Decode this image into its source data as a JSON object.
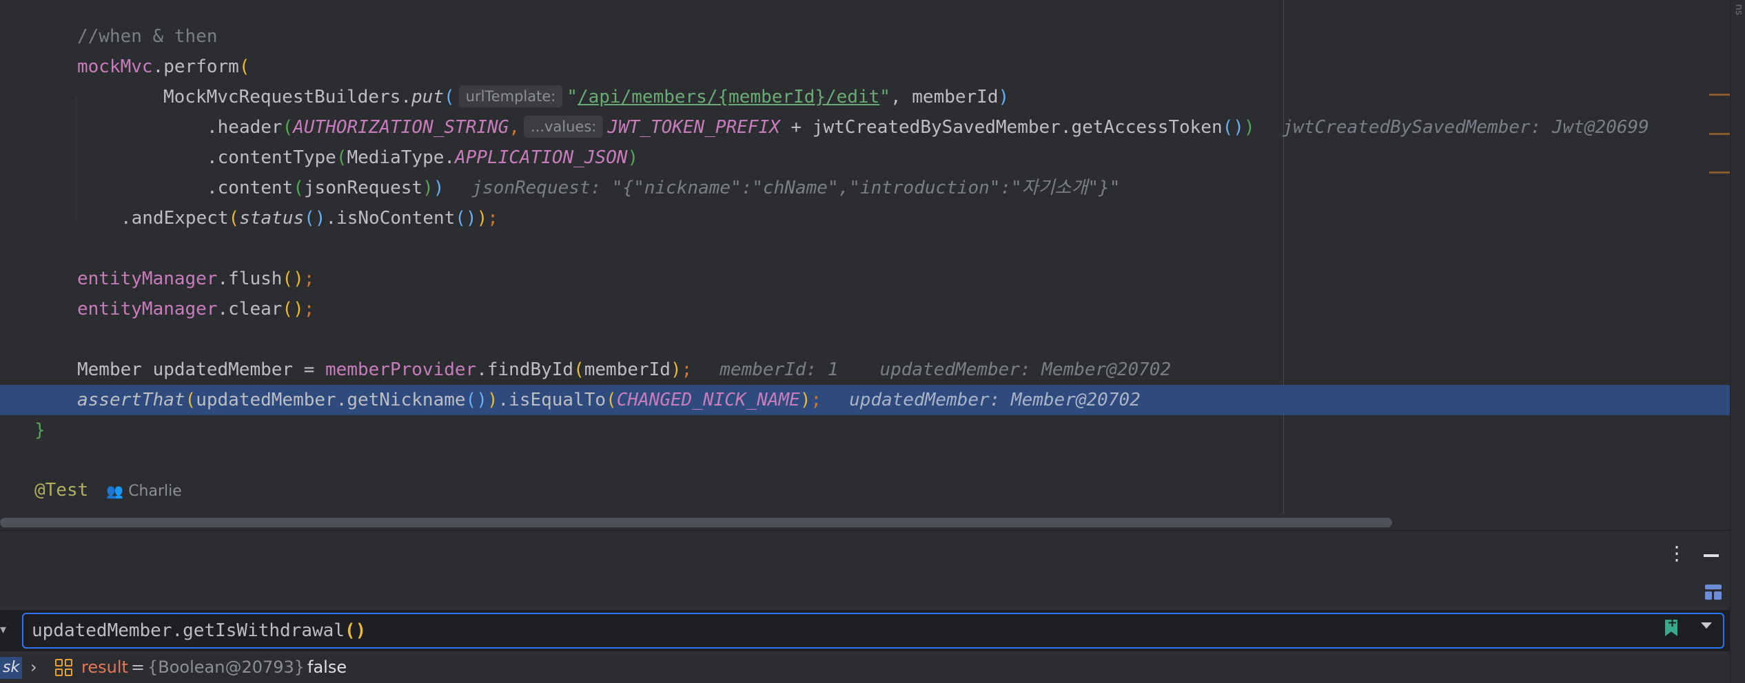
{
  "editor": {
    "lines": {
      "comment": "//when & then",
      "perform_obj": "mockMvc",
      "perform_call": ".perform",
      "builders": "MockMvcRequestBuilders.",
      "put": "put",
      "hint_url": "urlTemplate:",
      "url": "/api/members/{memberId}/edit",
      "member_id_arg": ", memberId",
      "header": ".header",
      "auth_const": "AUTHORIZATION_STRING",
      "hint_values": "...values:",
      "jwt_prefix": "JWT_TOKEN_PREFIX",
      "plus_token": " + jwtCreatedBySavedMember.getAccessToken",
      "dbg_jwt": "jwtCreatedBySavedMember: Jwt@20699",
      "content_type": ".contentType",
      "media_type": "MediaType.",
      "app_json": "APPLICATION_JSON",
      "content": ".content",
      "json_request": "jsonRequest",
      "dbg_json": "jsonRequest: \"{\"nickname\":\"chName\",\"introduction\":\"자기소개\"}\"",
      "and_expect": ".andExpect",
      "status": "status",
      "is_no_content": ".isNoContent",
      "em": "entityManager",
      "flush": ".flush",
      "clear": ".clear",
      "member_decl": "Member updatedMember = ",
      "provider": "memberProvider",
      "find_by_id": ".findById",
      "member_id": "memberId",
      "dbg_member_id": "memberId: 1",
      "dbg_updated": "updatedMember: Member@20702",
      "assert_that": "assertThat",
      "updated_nick": "updatedMember.getNickname",
      "is_equal_to": ".isEqualTo",
      "changed_nick": "CHANGED_NICK_NAME",
      "dbg_updated_2": "updatedMember: Member@20702",
      "close_brace": "}",
      "test_ann": "@Test",
      "author": "Charlie"
    }
  },
  "right_strip": {
    "label": "ns"
  },
  "evaluate": {
    "expression": "updatedMember.getIsWithdrawal",
    "expression_parens": "()"
  },
  "result": {
    "left_cut": "sk",
    "name": "result",
    "eq": "=",
    "type": "{Boolean@20793}",
    "value": "false"
  },
  "colors": {
    "selection": "#2f4a7c",
    "accent": "#3574f0",
    "bookmark": "#3ba88b"
  }
}
